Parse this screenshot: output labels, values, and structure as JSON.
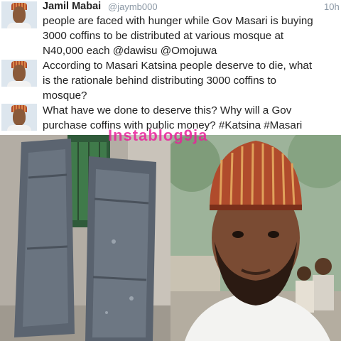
{
  "tweets": [
    {
      "display_name": "Jamil Mabai",
      "handle": "@jaymb000",
      "timestamp": "10h",
      "text": "people are faced with hunger while Gov Masari is buying\n3000 coffins to be distributed at various mosque at\nN40,000 each @dawisu @Omojuwa"
    },
    {
      "text": "According to Masari Katsina people deserve to die, what\nis the rationale behind distributing 3000 coffins to\nmosque?"
    },
    {
      "text": "What have we done to deserve this? Why will a Gov\npurchase coffins with public money? #Katsina #Masari"
    }
  ],
  "watermark": "Instablog9ja",
  "colors": {
    "name_text": "#222222",
    "handle_text": "#8b98a5",
    "watermark": "#e9219b",
    "coffin_metal": "#5b6470",
    "cap_pattern": "#b04b2c"
  },
  "icons": [
    "avatar"
  ]
}
